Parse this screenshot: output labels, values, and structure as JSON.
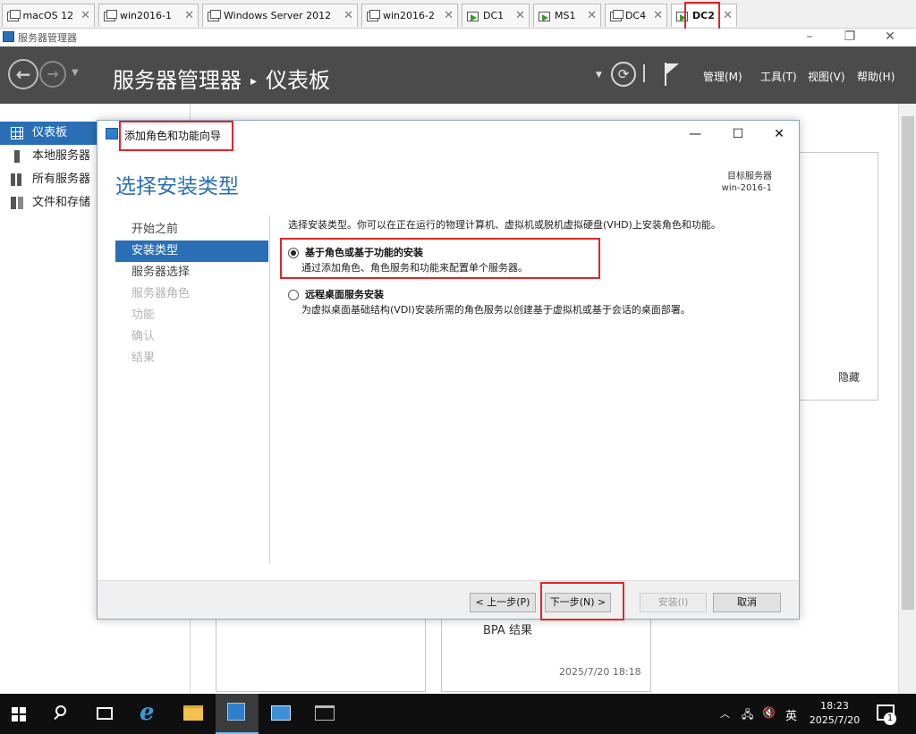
{
  "vm_tabs": [
    {
      "label": "macOS 12",
      "icon": "vm-icon"
    },
    {
      "label": "win2016-1",
      "icon": "vm-icon"
    },
    {
      "label": "Windows Server 2012",
      "icon": "vm-icon"
    },
    {
      "label": "win2016-2",
      "icon": "vm-icon"
    },
    {
      "label": "DC1",
      "icon": "vm-running-icon"
    },
    {
      "label": "MS1",
      "icon": "vm-running-icon"
    },
    {
      "label": "DC4",
      "icon": "vm-icon"
    },
    {
      "label": "DC2",
      "icon": "vm-running-icon",
      "active": true
    }
  ],
  "app": {
    "window_title": "服务器管理器",
    "breadcrumb_root": "服务器管理器",
    "breadcrumb_sep": "▸",
    "breadcrumb_page": "仪表板",
    "menus": [
      "管理(M)",
      "工具(T)",
      "视图(V)",
      "帮助(H)"
    ]
  },
  "sidebar": {
    "items": [
      {
        "label": "仪表板",
        "active": true
      },
      {
        "label": "本地服务器"
      },
      {
        "label": "所有服务器"
      },
      {
        "label": "文件和存储"
      }
    ]
  },
  "background": {
    "hide_label": "隐藏",
    "bpa_label": "BPA 结果",
    "timestamp": "2025/7/20 18:18"
  },
  "dialog": {
    "title": "添加角色和功能向导",
    "heading": "选择安装类型",
    "target_label": "目标服务器",
    "target_name": "win-2016-1",
    "steps": [
      {
        "label": "开始之前",
        "state": "normal"
      },
      {
        "label": "安装类型",
        "state": "active"
      },
      {
        "label": "服务器选择",
        "state": "normal"
      },
      {
        "label": "服务器角色",
        "state": "disabled"
      },
      {
        "label": "功能",
        "state": "disabled"
      },
      {
        "label": "确认",
        "state": "disabled"
      },
      {
        "label": "结果",
        "state": "disabled"
      }
    ],
    "description": "选择安装类型。你可以在正在运行的物理计算机、虚拟机或脱机虚拟硬盘(VHD)上安装角色和功能。",
    "options": [
      {
        "title": "基于角色或基于功能的安装",
        "sub": "通过添加角色、角色服务和功能来配置单个服务器。",
        "selected": true
      },
      {
        "title": "远程桌面服务安装",
        "sub": "为虚拟桌面基础结构(VDI)安装所需的角色服务以创建基于虚拟机或基于会话的桌面部署。",
        "selected": false
      }
    ],
    "buttons": {
      "prev": "< 上一步(P)",
      "next": "下一步(N) >",
      "install": "安装(I)",
      "cancel": "取消"
    }
  },
  "taskbar": {
    "ime": "英",
    "time": "18:23",
    "date": "2025/7/20",
    "notification_count": "1"
  },
  "colors": {
    "accent": "#2a6fb5",
    "header_bg": "#4b4b4b",
    "highlight_red": "#e0262b",
    "taskbar_bg": "#0f0f10"
  }
}
